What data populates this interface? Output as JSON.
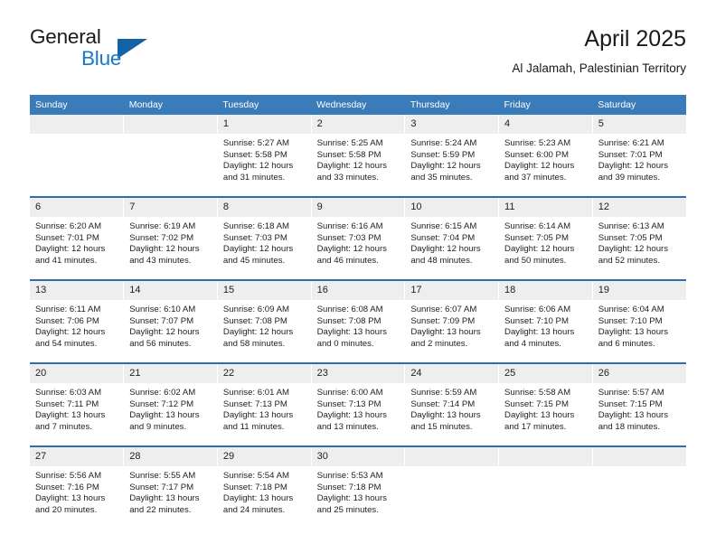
{
  "brand": {
    "name_part1": "General",
    "name_part2": "Blue",
    "logo_icon": "blue-triangle-icon"
  },
  "header": {
    "title": "April 2025",
    "subtitle": "Al Jalamah, Palestinian Territory"
  },
  "colors": {
    "header_blue": "#3a7cba",
    "separator_blue": "#2f6fae",
    "daynum_band": "#eeeeee",
    "brand_blue": "#1878c8",
    "logo_blue": "#1362a5",
    "text": "#222222"
  },
  "calendar": {
    "weekday_headers": [
      "Sunday",
      "Monday",
      "Tuesday",
      "Wednesday",
      "Thursday",
      "Friday",
      "Saturday"
    ],
    "weeks": [
      [
        {
          "day": "",
          "sunrise": "",
          "sunset": "",
          "daylight1": "",
          "daylight2": ""
        },
        {
          "day": "",
          "sunrise": "",
          "sunset": "",
          "daylight1": "",
          "daylight2": ""
        },
        {
          "day": "1",
          "sunrise": "Sunrise: 5:27 AM",
          "sunset": "Sunset: 5:58 PM",
          "daylight1": "Daylight: 12 hours",
          "daylight2": "and 31 minutes."
        },
        {
          "day": "2",
          "sunrise": "Sunrise: 5:25 AM",
          "sunset": "Sunset: 5:58 PM",
          "daylight1": "Daylight: 12 hours",
          "daylight2": "and 33 minutes."
        },
        {
          "day": "3",
          "sunrise": "Sunrise: 5:24 AM",
          "sunset": "Sunset: 5:59 PM",
          "daylight1": "Daylight: 12 hours",
          "daylight2": "and 35 minutes."
        },
        {
          "day": "4",
          "sunrise": "Sunrise: 5:23 AM",
          "sunset": "Sunset: 6:00 PM",
          "daylight1": "Daylight: 12 hours",
          "daylight2": "and 37 minutes."
        },
        {
          "day": "5",
          "sunrise": "Sunrise: 6:21 AM",
          "sunset": "Sunset: 7:01 PM",
          "daylight1": "Daylight: 12 hours",
          "daylight2": "and 39 minutes."
        }
      ],
      [
        {
          "day": "6",
          "sunrise": "Sunrise: 6:20 AM",
          "sunset": "Sunset: 7:01 PM",
          "daylight1": "Daylight: 12 hours",
          "daylight2": "and 41 minutes."
        },
        {
          "day": "7",
          "sunrise": "Sunrise: 6:19 AM",
          "sunset": "Sunset: 7:02 PM",
          "daylight1": "Daylight: 12 hours",
          "daylight2": "and 43 minutes."
        },
        {
          "day": "8",
          "sunrise": "Sunrise: 6:18 AM",
          "sunset": "Sunset: 7:03 PM",
          "daylight1": "Daylight: 12 hours",
          "daylight2": "and 45 minutes."
        },
        {
          "day": "9",
          "sunrise": "Sunrise: 6:16 AM",
          "sunset": "Sunset: 7:03 PM",
          "daylight1": "Daylight: 12 hours",
          "daylight2": "and 46 minutes."
        },
        {
          "day": "10",
          "sunrise": "Sunrise: 6:15 AM",
          "sunset": "Sunset: 7:04 PM",
          "daylight1": "Daylight: 12 hours",
          "daylight2": "and 48 minutes."
        },
        {
          "day": "11",
          "sunrise": "Sunrise: 6:14 AM",
          "sunset": "Sunset: 7:05 PM",
          "daylight1": "Daylight: 12 hours",
          "daylight2": "and 50 minutes."
        },
        {
          "day": "12",
          "sunrise": "Sunrise: 6:13 AM",
          "sunset": "Sunset: 7:05 PM",
          "daylight1": "Daylight: 12 hours",
          "daylight2": "and 52 minutes."
        }
      ],
      [
        {
          "day": "13",
          "sunrise": "Sunrise: 6:11 AM",
          "sunset": "Sunset: 7:06 PM",
          "daylight1": "Daylight: 12 hours",
          "daylight2": "and 54 minutes."
        },
        {
          "day": "14",
          "sunrise": "Sunrise: 6:10 AM",
          "sunset": "Sunset: 7:07 PM",
          "daylight1": "Daylight: 12 hours",
          "daylight2": "and 56 minutes."
        },
        {
          "day": "15",
          "sunrise": "Sunrise: 6:09 AM",
          "sunset": "Sunset: 7:08 PM",
          "daylight1": "Daylight: 12 hours",
          "daylight2": "and 58 minutes."
        },
        {
          "day": "16",
          "sunrise": "Sunrise: 6:08 AM",
          "sunset": "Sunset: 7:08 PM",
          "daylight1": "Daylight: 13 hours",
          "daylight2": "and 0 minutes."
        },
        {
          "day": "17",
          "sunrise": "Sunrise: 6:07 AM",
          "sunset": "Sunset: 7:09 PM",
          "daylight1": "Daylight: 13 hours",
          "daylight2": "and 2 minutes."
        },
        {
          "day": "18",
          "sunrise": "Sunrise: 6:06 AM",
          "sunset": "Sunset: 7:10 PM",
          "daylight1": "Daylight: 13 hours",
          "daylight2": "and 4 minutes."
        },
        {
          "day": "19",
          "sunrise": "Sunrise: 6:04 AM",
          "sunset": "Sunset: 7:10 PM",
          "daylight1": "Daylight: 13 hours",
          "daylight2": "and 6 minutes."
        }
      ],
      [
        {
          "day": "20",
          "sunrise": "Sunrise: 6:03 AM",
          "sunset": "Sunset: 7:11 PM",
          "daylight1": "Daylight: 13 hours",
          "daylight2": "and 7 minutes."
        },
        {
          "day": "21",
          "sunrise": "Sunrise: 6:02 AM",
          "sunset": "Sunset: 7:12 PM",
          "daylight1": "Daylight: 13 hours",
          "daylight2": "and 9 minutes."
        },
        {
          "day": "22",
          "sunrise": "Sunrise: 6:01 AM",
          "sunset": "Sunset: 7:13 PM",
          "daylight1": "Daylight: 13 hours",
          "daylight2": "and 11 minutes."
        },
        {
          "day": "23",
          "sunrise": "Sunrise: 6:00 AM",
          "sunset": "Sunset: 7:13 PM",
          "daylight1": "Daylight: 13 hours",
          "daylight2": "and 13 minutes."
        },
        {
          "day": "24",
          "sunrise": "Sunrise: 5:59 AM",
          "sunset": "Sunset: 7:14 PM",
          "daylight1": "Daylight: 13 hours",
          "daylight2": "and 15 minutes."
        },
        {
          "day": "25",
          "sunrise": "Sunrise: 5:58 AM",
          "sunset": "Sunset: 7:15 PM",
          "daylight1": "Daylight: 13 hours",
          "daylight2": "and 17 minutes."
        },
        {
          "day": "26",
          "sunrise": "Sunrise: 5:57 AM",
          "sunset": "Sunset: 7:15 PM",
          "daylight1": "Daylight: 13 hours",
          "daylight2": "and 18 minutes."
        }
      ],
      [
        {
          "day": "27",
          "sunrise": "Sunrise: 5:56 AM",
          "sunset": "Sunset: 7:16 PM",
          "daylight1": "Daylight: 13 hours",
          "daylight2": "and 20 minutes."
        },
        {
          "day": "28",
          "sunrise": "Sunrise: 5:55 AM",
          "sunset": "Sunset: 7:17 PM",
          "daylight1": "Daylight: 13 hours",
          "daylight2": "and 22 minutes."
        },
        {
          "day": "29",
          "sunrise": "Sunrise: 5:54 AM",
          "sunset": "Sunset: 7:18 PM",
          "daylight1": "Daylight: 13 hours",
          "daylight2": "and 24 minutes."
        },
        {
          "day": "30",
          "sunrise": "Sunrise: 5:53 AM",
          "sunset": "Sunset: 7:18 PM",
          "daylight1": "Daylight: 13 hours",
          "daylight2": "and 25 minutes."
        },
        {
          "day": "",
          "sunrise": "",
          "sunset": "",
          "daylight1": "",
          "daylight2": ""
        },
        {
          "day": "",
          "sunrise": "",
          "sunset": "",
          "daylight1": "",
          "daylight2": ""
        },
        {
          "day": "",
          "sunrise": "",
          "sunset": "",
          "daylight1": "",
          "daylight2": ""
        }
      ]
    ]
  }
}
